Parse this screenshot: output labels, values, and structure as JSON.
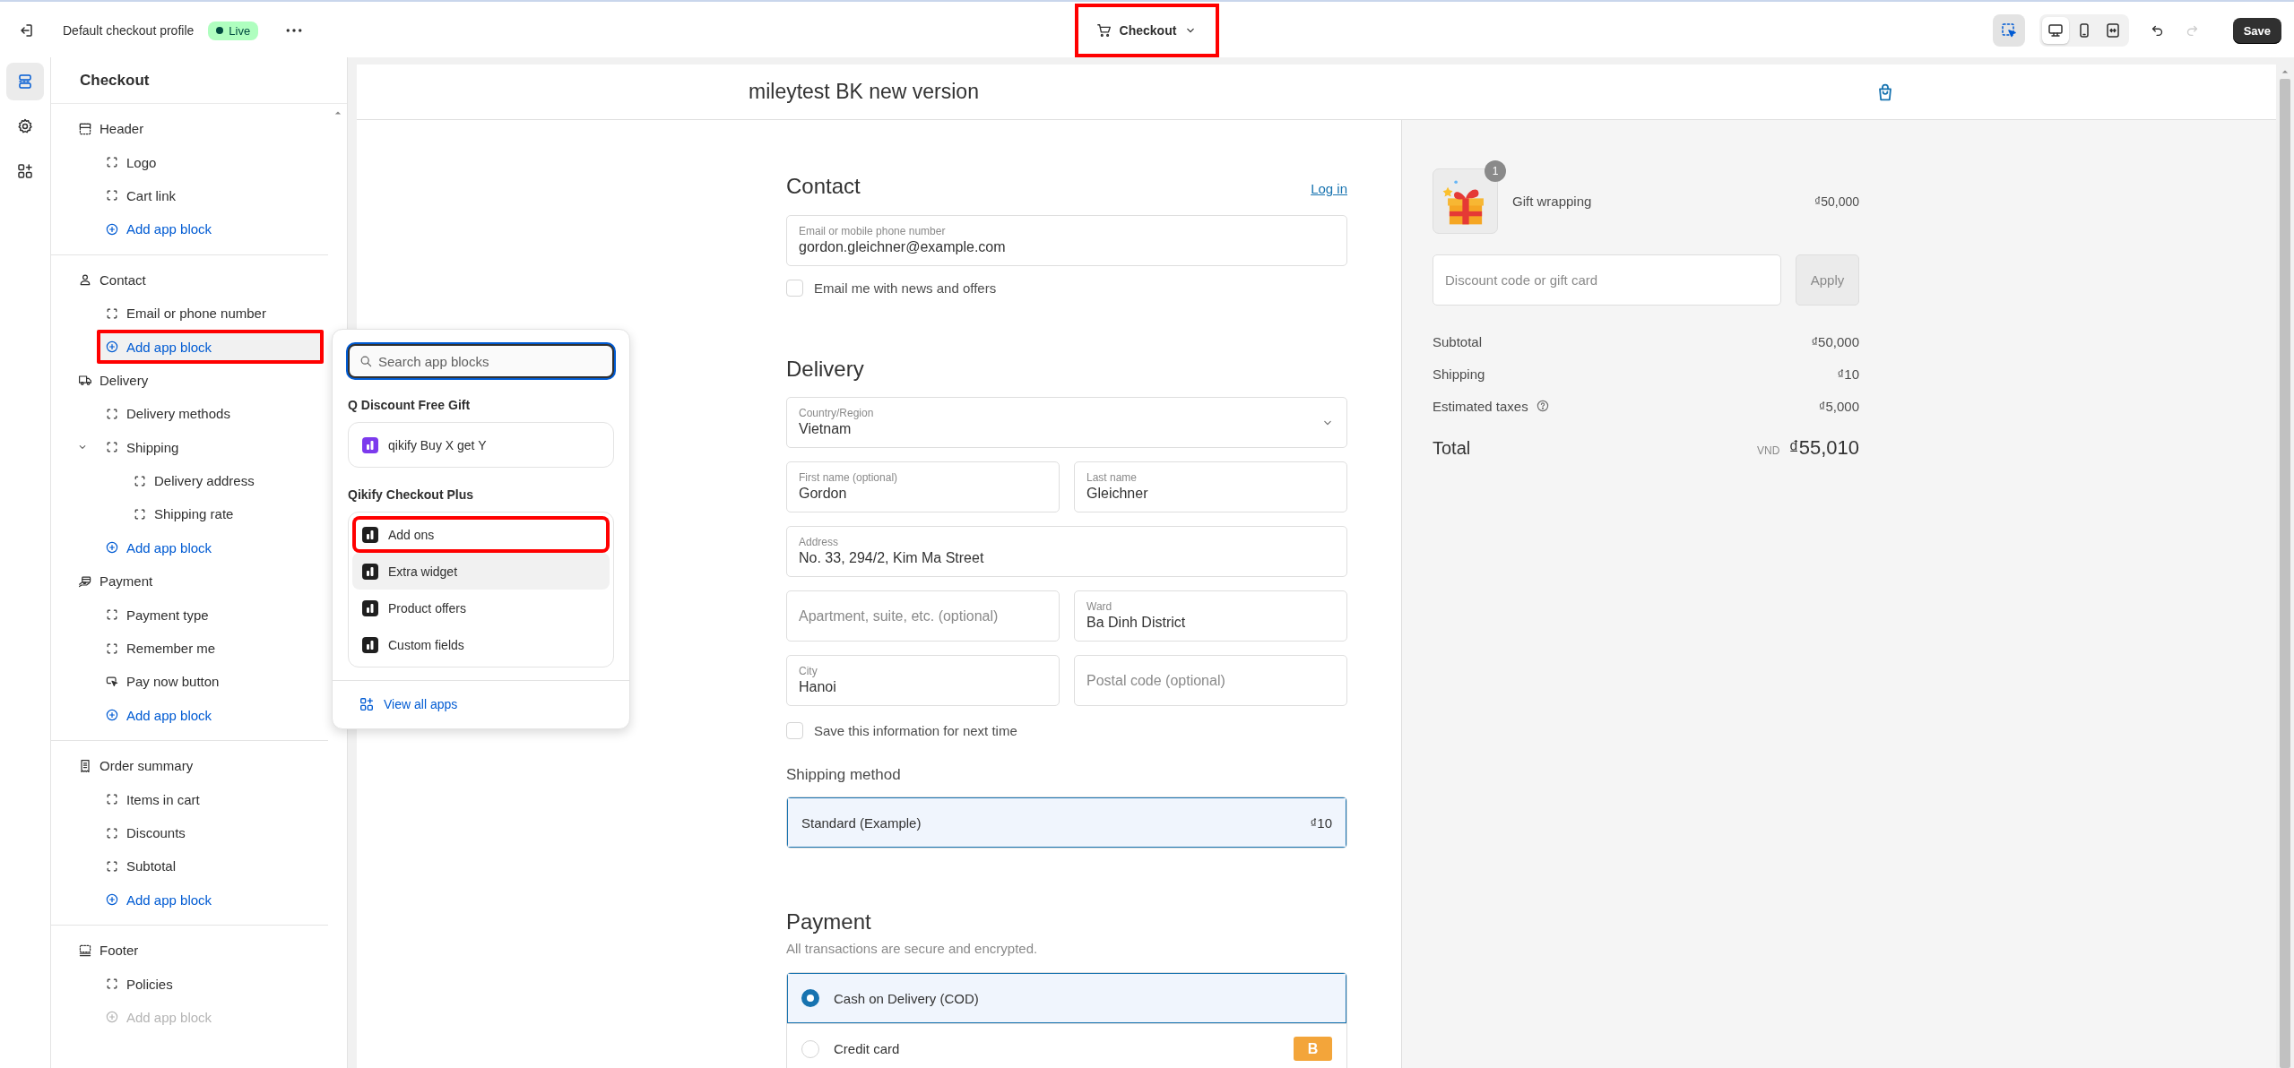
{
  "topbar": {
    "profile_name": "Default checkout profile",
    "status": "Live",
    "page_selector": {
      "label": "Checkout",
      "highlighted": true
    },
    "inspector": {
      "on": true
    },
    "views": [
      {
        "selected": true
      },
      {
        "selected": false
      },
      {
        "selected": false
      }
    ],
    "undo": {
      "disabled": false
    },
    "redo": {
      "disabled": true
    },
    "save_label": "Save"
  },
  "rail": [
    {
      "selected": true
    },
    {
      "selected": false
    },
    {
      "selected": false
    }
  ],
  "sidebar": {
    "title": "Checkout",
    "groups": [
      {
        "sections": [
          {
            "label": "Header",
            "children": [
              {
                "kind": "block",
                "label": "Logo",
                "highlighted": false
              },
              {
                "kind": "block",
                "label": "Cart link",
                "highlighted": false
              },
              {
                "kind": "add",
                "label": "Add app block",
                "disabled": false,
                "highlighted": false
              }
            ]
          }
        ]
      },
      {
        "sections": [
          {
            "label": "Contact",
            "children": [
              {
                "kind": "block",
                "label": "Email or phone number",
                "highlighted": false
              },
              {
                "kind": "add",
                "label": "Add app block",
                "disabled": false,
                "highlighted": true
              }
            ]
          },
          {
            "label": "Delivery",
            "children": [
              {
                "kind": "block",
                "label": "Delivery methods",
                "highlighted": false
              },
              {
                "kind": "block",
                "label": "Shipping",
                "highlighted": false,
                "expanded": true,
                "children": [
                  {
                    "kind": "block",
                    "label": "Delivery address",
                    "highlighted": false
                  },
                  {
                    "kind": "block",
                    "label": "Shipping rate",
                    "highlighted": false
                  }
                ]
              },
              {
                "kind": "add",
                "label": "Add app block",
                "disabled": false,
                "highlighted": false
              }
            ]
          },
          {
            "label": "Payment",
            "children": [
              {
                "kind": "block",
                "label": "Payment type",
                "highlighted": false
              },
              {
                "kind": "block",
                "label": "Remember me",
                "highlighted": false
              },
              {
                "kind": "button",
                "label": "Pay now button",
                "highlighted": false
              },
              {
                "kind": "add",
                "label": "Add app block",
                "disabled": false,
                "highlighted": false
              }
            ]
          }
        ]
      },
      {
        "sections": [
          {
            "label": "Order summary",
            "children": [
              {
                "kind": "block",
                "label": "Items in cart",
                "highlighted": false
              },
              {
                "kind": "block",
                "label": "Discounts",
                "highlighted": false
              },
              {
                "kind": "block",
                "label": "Subtotal",
                "highlighted": false
              },
              {
                "kind": "add",
                "label": "Add app block",
                "disabled": false,
                "highlighted": false
              }
            ]
          }
        ]
      },
      {
        "sections": [
          {
            "label": "Footer",
            "children": [
              {
                "kind": "block",
                "label": "Policies",
                "highlighted": false
              },
              {
                "kind": "add",
                "label": "Add app block",
                "disabled": true,
                "highlighted": false
              }
            ]
          }
        ]
      }
    ]
  },
  "popover": {
    "search_placeholder": "Search app blocks",
    "groups": [
      {
        "title": "Q Discount Free Gift",
        "apps": [
          {
            "label": "qikify Buy X get Y",
            "color": "#7c3aed",
            "highlighted": false,
            "hovered": false
          }
        ]
      },
      {
        "title": "Qikify Checkout Plus",
        "apps": [
          {
            "label": "Add ons",
            "color": "#1f1f1f",
            "highlighted": true,
            "hovered": false
          },
          {
            "label": "Extra widget",
            "color": "#1f1f1f",
            "highlighted": false,
            "hovered": true
          },
          {
            "label": "Product offers",
            "color": "#1f1f1f",
            "highlighted": false,
            "hovered": false
          },
          {
            "label": "Custom fields",
            "color": "#1f1f1f",
            "highlighted": false,
            "hovered": false
          }
        ]
      }
    ],
    "footer_link": "View all apps"
  },
  "preview": {
    "store_name": "mileytest BK new version",
    "contact": {
      "heading": "Contact",
      "login_link": "Log in",
      "fields": [
        {
          "kind": "text",
          "label": "Email or mobile phone number",
          "value": "gordon.gleichner@example.com"
        }
      ],
      "newsletter": {
        "label": "Email me with news and offers",
        "checked": false
      }
    },
    "delivery": {
      "heading": "Delivery",
      "rows": [
        [
          {
            "kind": "select",
            "label": "Country/Region",
            "value": "Vietnam"
          }
        ],
        [
          {
            "kind": "text",
            "label": "First name (optional)",
            "value": "Gordon"
          },
          {
            "kind": "text",
            "label": "Last name",
            "value": "Gleichner"
          }
        ],
        [
          {
            "kind": "text",
            "label": "Address",
            "value": "No. 33, 294/2, Kim Ma Street"
          }
        ],
        [
          {
            "kind": "text",
            "placeholder": "Apartment, suite, etc. (optional)"
          },
          {
            "kind": "text",
            "label": "Ward",
            "value": "Ba Dinh District"
          }
        ],
        [
          {
            "kind": "text",
            "label": "City",
            "value": "Hanoi"
          },
          {
            "kind": "text",
            "placeholder": "Postal code (optional)"
          }
        ]
      ],
      "save_info": {
        "label": "Save this information for next time",
        "checked": false
      }
    },
    "shipping": {
      "heading": "Shipping method",
      "options": [
        {
          "label": "Standard (Example)",
          "price": "₫10",
          "selected": true
        }
      ]
    },
    "payment": {
      "heading": "Payment",
      "subtitle": "All transactions are secure and encrypted.",
      "options": [
        {
          "label": "Cash on Delivery (COD)",
          "selected": true
        },
        {
          "label": "Credit card",
          "selected": false,
          "badge": "B"
        }
      ]
    }
  },
  "summary": {
    "items": [
      {
        "name": "Gift wrapping",
        "quantity": "1",
        "price": "₫50,000"
      }
    ],
    "discount": {
      "placeholder": "Discount code or gift card",
      "apply_label": "Apply",
      "apply_disabled": true
    },
    "lines": [
      {
        "label": "Subtotal",
        "value": "₫50,000",
        "info": false
      },
      {
        "label": "Shipping",
        "value": "₫10",
        "info": false
      },
      {
        "label": "Estimated taxes",
        "value": "₫5,000",
        "info": true
      }
    ],
    "total": {
      "label": "Total",
      "currency": "VND",
      "value": "₫55,010"
    }
  }
}
